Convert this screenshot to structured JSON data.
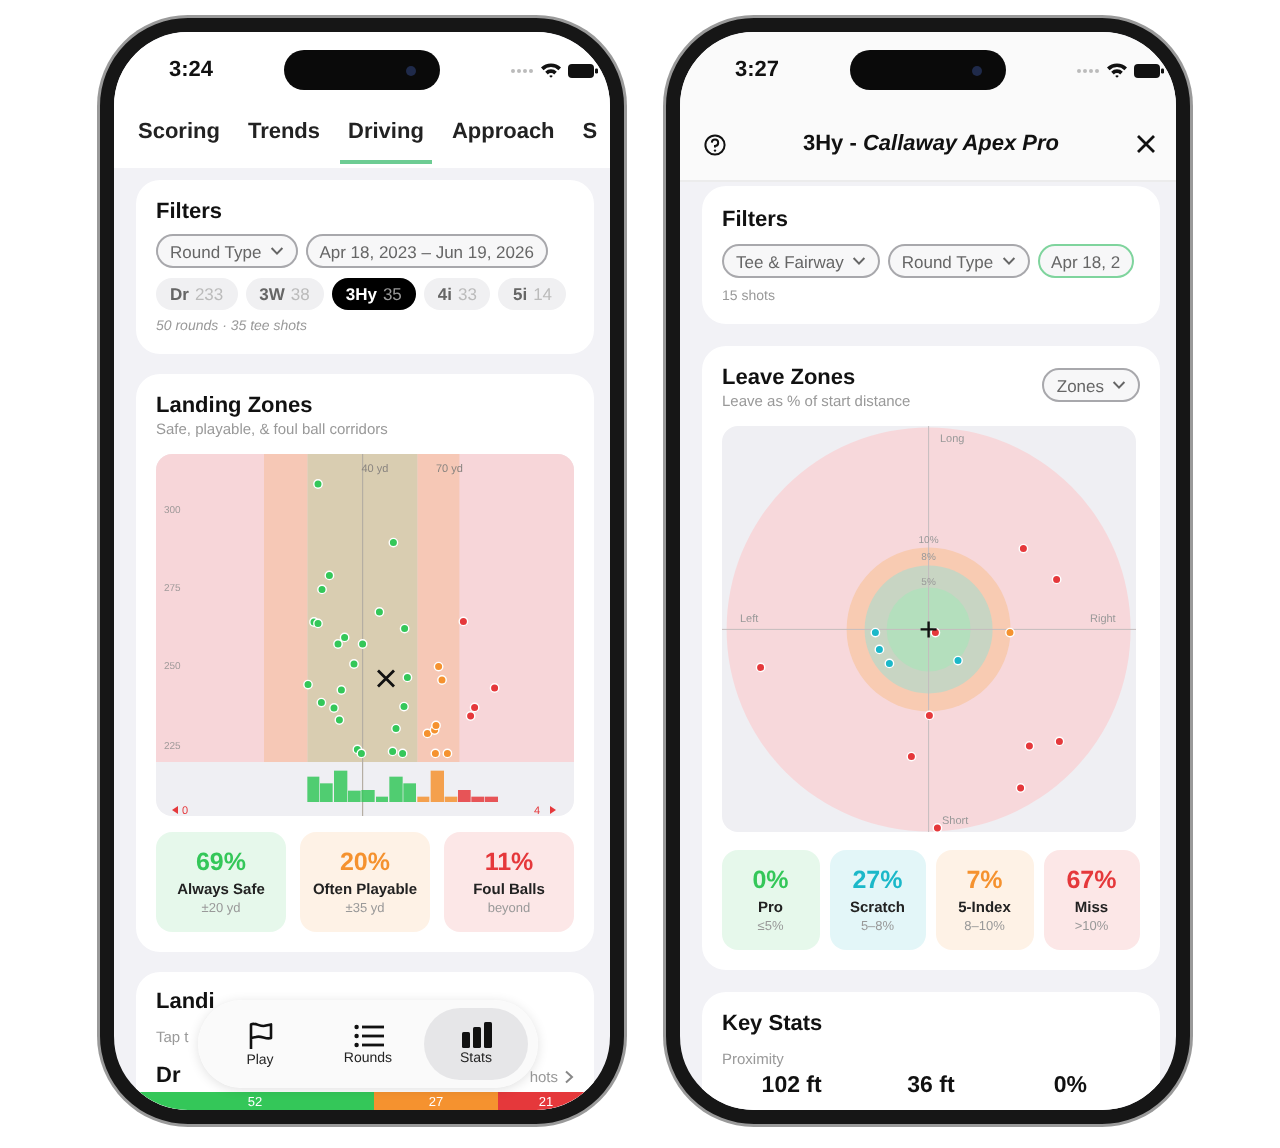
{
  "left_phone": {
    "status_time": "3:24",
    "tabs": [
      {
        "label": "Scoring",
        "selected": false
      },
      {
        "label": "Trends",
        "selected": false
      },
      {
        "label": "Driving",
        "selected": true
      },
      {
        "label": "Approach",
        "selected": false
      },
      {
        "label": "S",
        "selected": false
      }
    ],
    "filters": {
      "title": "Filters",
      "chips": [
        {
          "label": "Round Type",
          "kind": "dropdown",
          "highlighted": false
        },
        {
          "label": "Apr 18, 2023 – Jun 19, 2026",
          "kind": "range",
          "highlighted": false
        }
      ],
      "clubs": [
        {
          "name": "Dr",
          "count": "233",
          "selected": false
        },
        {
          "name": "3W",
          "count": "38",
          "selected": false
        },
        {
          "name": "3Hy",
          "count": "35",
          "selected": true
        },
        {
          "name": "4i",
          "count": "33",
          "selected": false
        },
        {
          "name": "5i",
          "count": "14",
          "selected": false
        }
      ],
      "summary": "50 rounds · 35 tee shots"
    },
    "landing_zones": {
      "title": "Landing Zones",
      "subtitle": "Safe, playable, & foul ball corridors",
      "chart": {
        "corridor_labels": [
          "40 yd",
          "70 yd"
        ],
        "y_labels": [
          "300",
          "275",
          "250",
          "225"
        ],
        "left_count": "0",
        "right_count": "4"
      },
      "tiles": [
        {
          "value": "69%",
          "label": "Always Safe",
          "range": "±20 yd",
          "color": "#34c759"
        },
        {
          "value": "20%",
          "label": "Often Playable",
          "range": "±35 yd",
          "color": "#f5922f"
        },
        {
          "value": "11%",
          "label": "Foul Balls",
          "range": "beyond",
          "color": "#e5383b"
        }
      ]
    },
    "next_card": {
      "title": "Landi",
      "subtitle": "Tap t",
      "club": "Dr",
      "link": "hots",
      "segments": [
        {
          "value": "52",
          "color": "#34c759"
        },
        {
          "value": "27",
          "color": "#f5922f"
        },
        {
          "value": "21",
          "color": "#e5383b"
        }
      ]
    },
    "tab_bar": [
      {
        "label": "Play",
        "kind": "flag",
        "selected": false
      },
      {
        "label": "Rounds",
        "kind": "list",
        "selected": false
      },
      {
        "label": "Stats",
        "kind": "bars",
        "selected": true
      }
    ]
  },
  "right_phone": {
    "status_time": "3:27",
    "title": "**3Hy -** *Callaway Apex Pro*",
    "filters": {
      "title": "Filters",
      "chips": [
        {
          "label": "Tee & Fairway",
          "kind": "dropdown",
          "highlighted": false
        },
        {
          "label": "Round Type",
          "kind": "dropdown",
          "highlighted": false
        },
        {
          "label": "Apr 18, 2",
          "kind": "range",
          "highlighted": true
        }
      ],
      "summary": "15 shots"
    },
    "leave_zones": {
      "title": "Leave Zones",
      "subtitle": "Leave as % of start distance",
      "view_menu": "Zones",
      "chart": {
        "long": "Long",
        "short": "Short",
        "left": "Left",
        "right": "Right",
        "ring_labels": [
          "10%",
          "8%",
          "5%"
        ]
      },
      "tiles": [
        {
          "value": "0%",
          "label": "Pro",
          "range": "≤5%",
          "color": "#34c759"
        },
        {
          "value": "27%",
          "label": "Scratch",
          "range": "5–8%",
          "color": "#1bb8c9"
        },
        {
          "value": "7%",
          "label": "5-Index",
          "range": "8–10%",
          "color": "#f5922f"
        },
        {
          "value": "67%",
          "label": "Miss",
          "range": ">10%",
          "color": "#e5383b"
        }
      ]
    },
    "key_stats": {
      "title": "Key Stats",
      "section": "Proximity",
      "values": [
        "102 ft",
        "36 ft",
        "0%"
      ]
    }
  }
}
